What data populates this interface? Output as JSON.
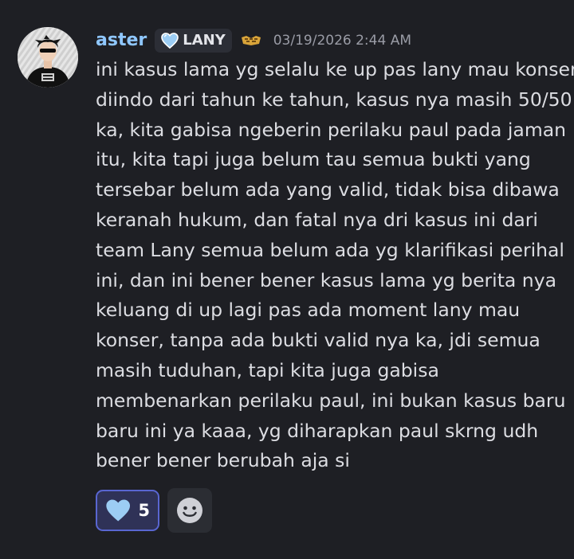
{
  "message": {
    "author": "aster",
    "role_tag": "LANY",
    "timestamp": "03/19/2026 2:44 AM",
    "lines": [
      "ini kasus lama yg selalu ke up pas lany mau konser",
      "diindo dari tahun ke tahun, kasus nya masih 50/50",
      "ka, kita gabisa ngeberin perilaku paul pada jaman",
      "itu, kita tapi juga belum tau semua bukti yang",
      "tersebar belum ada yang valid, tidak bisa dibawa",
      "keranah hukum, dan fatal nya dri kasus ini dari",
      "team Lany semua belum ada yg klarifikasi perihal",
      "ini, dan ini bener bener kasus lama yg berita nya",
      "keluang di up lagi pas ada moment lany mau",
      "konser, tanpa ada bukti valid nya ka, jdi semua",
      "masih tuduhan, tapi kita juga gabisa",
      "membenarkan perilaku paul, ini bukan kasus baru",
      "baru ini ya kaaa, yg diharapkan paul skrng udh",
      "bener bener berubah aja si"
    ]
  },
  "reactions": [
    {
      "icon": "light-blue-heart-icon",
      "count": "5",
      "active": true
    }
  ],
  "add_reaction": {
    "icon": "smiley-icon"
  },
  "colors": {
    "background": "#1e1f24",
    "username": "#8fc7ff",
    "text": "#dcdde2",
    "timestamp": "#9a9ca6",
    "reaction_border": "#5966d1",
    "reaction_bg": "#2f3257",
    "heart": "#9ccdf4"
  }
}
